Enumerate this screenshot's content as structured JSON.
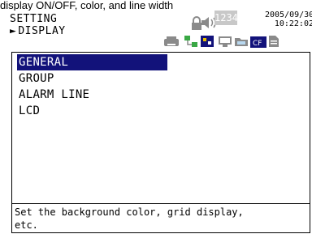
{
  "caption": "display ON/OFF, color, and line width",
  "header": {
    "title": "SETTING",
    "subtitle_arrow": "►",
    "subtitle": "DISPLAY",
    "status_digits": "1234",
    "date": "2005/09/30",
    "time": "10:22:02",
    "icons": [
      "record-icon",
      "lock-icon",
      "speaker-icon",
      "network-icon",
      "cf-card-icon",
      "folder-icon",
      "memory-icon"
    ]
  },
  "menu": {
    "items": [
      {
        "label": "GENERAL",
        "selected": true
      },
      {
        "label": "GROUP",
        "selected": false
      },
      {
        "label": "ALARM LINE",
        "selected": false
      },
      {
        "label": "LCD",
        "selected": false
      }
    ]
  },
  "help": {
    "line1": "Set the background color, grid display,",
    "line2": "etc."
  },
  "colors": {
    "selection": "#12127a",
    "digits_bg": "#c8c8c8",
    "icon_gray": "#8a8a8a",
    "icon_green": "#3aa845",
    "icon_navy": "#12127a"
  }
}
